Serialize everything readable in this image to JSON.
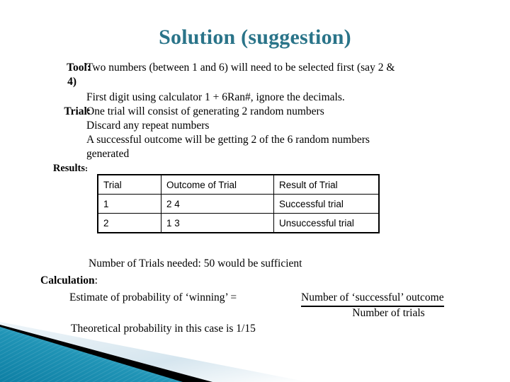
{
  "slide": {
    "title": "Solution (suggestion)"
  },
  "colors": {
    "title_teal": "#2a7489",
    "deco_teal_dark": "#0f7fa3",
    "deco_teal_light": "#5bb8d4",
    "deco_black": "#000000",
    "deco_pale": "#dce9f0"
  },
  "content": {
    "tool": {
      "label": "Tool",
      "colon": ":",
      "text": "Two numbers (between 1 and 6) will need to be selected first (say 2 &",
      "wrap": "4)",
      "text2": "First digit using calculator 1 + 6Ran#, ignore the decimals."
    },
    "trial": {
      "label": "Trial",
      "colon": ":",
      "line1": "One trial will consist of generating 2 random numbers",
      "line2": "Discard any repeat numbers",
      "line3": "A successful outcome will be getting 2 of the 6 random numbers",
      "line4": "generated"
    },
    "results": {
      "label": "Results",
      "colon": ":"
    }
  },
  "table": {
    "headers": [
      "Trial",
      "Outcome of Trial",
      "Result of Trial"
    ],
    "rows": [
      [
        "1",
        "2 4",
        "Successful trial"
      ],
      [
        "2",
        "1 3",
        "Unsuccessful trial"
      ]
    ]
  },
  "bottom": {
    "trials_needed": "Number of Trials needed:  50 would be sufficient",
    "calculation_label": "Calculation",
    "calculation_colon": ":",
    "estimate_text": "Estimate of probability of ‘winning’ =",
    "fraction_numerator": "Number of ‘successful’ outcome",
    "fraction_denominator": "Number of trials",
    "theoretical": "Theoretical probability in this case is 1/15"
  }
}
